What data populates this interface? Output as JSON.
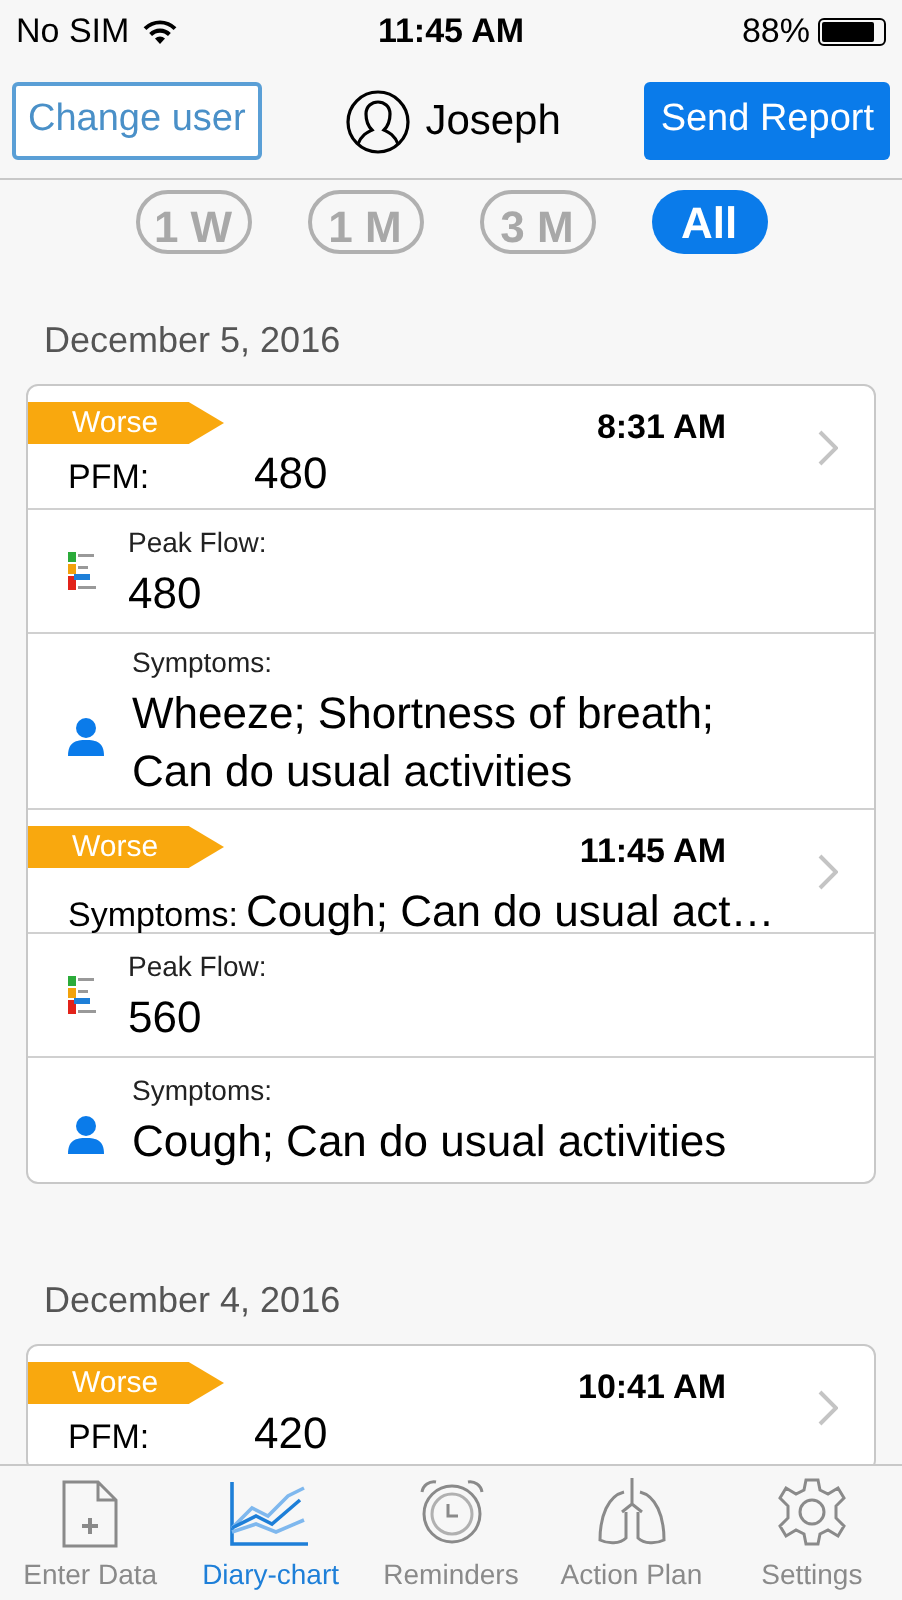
{
  "status_bar": {
    "carrier": "No SIM",
    "time": "11:45 AM",
    "battery": "88%"
  },
  "header": {
    "left_button": "Change user",
    "user": "Joseph",
    "right_button": "Send Report"
  },
  "ranges": [
    {
      "label": "1 W",
      "selected": false
    },
    {
      "label": "1 M",
      "selected": false
    },
    {
      "label": "3 M",
      "selected": false
    },
    {
      "label": "All",
      "selected": true
    }
  ],
  "days": [
    {
      "date": "December 5, 2016",
      "entries": [
        {
          "badge": "Worse",
          "time": "8:31 AM",
          "summary": {
            "kind": "pfm",
            "label": "PFM:",
            "value": "480"
          },
          "details": [
            {
              "kind": "peak_flow",
              "label": "Peak Flow:",
              "value": "480"
            },
            {
              "kind": "symptoms",
              "label": "Symptoms:",
              "value": "Wheeze; Shortness of breath; Can do usual activities"
            }
          ]
        },
        {
          "badge": "Worse",
          "time": "11:45 AM",
          "summary": {
            "kind": "symptoms",
            "label": "Symptoms:",
            "value": "Cough; Can do usual act…"
          },
          "details": [
            {
              "kind": "peak_flow",
              "label": "Peak Flow:",
              "value": "560"
            },
            {
              "kind": "symptoms",
              "label": "Symptoms:",
              "value": "Cough; Can do usual activities"
            }
          ]
        }
      ]
    },
    {
      "date": "December 4, 2016",
      "entries": [
        {
          "badge": "Worse",
          "time": "10:41 AM",
          "summary": {
            "kind": "pfm",
            "label": "PFM:",
            "value": "420"
          }
        }
      ]
    }
  ],
  "tabs": [
    {
      "kind": "enter",
      "label": "Enter Data",
      "selected": false
    },
    {
      "kind": "chart",
      "label": "Diary-chart",
      "selected": true
    },
    {
      "kind": "alarm",
      "label": "Reminders",
      "selected": false
    },
    {
      "kind": "lungs",
      "label": "Action Plan",
      "selected": false
    },
    {
      "kind": "gear",
      "label": "Settings",
      "selected": false
    }
  ]
}
